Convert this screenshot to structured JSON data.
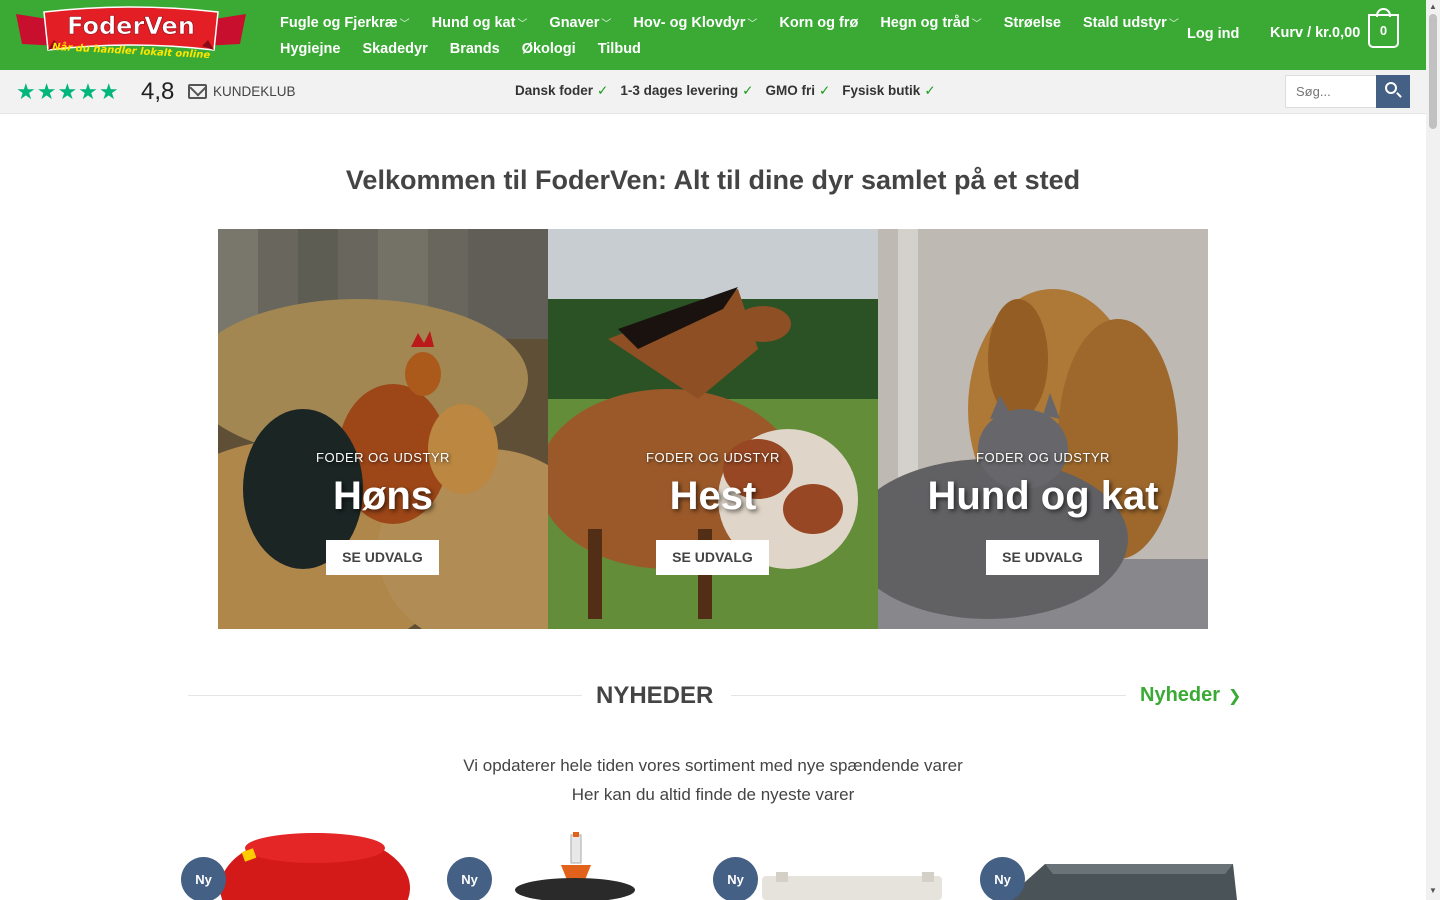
{
  "header": {
    "brand": "FoderVen",
    "tagline": "Når du handler lokalt online",
    "nav_row1": [
      "Fugle og Fjerkræ",
      "Hund og kat",
      "Gnaver",
      "Hov- og Klovdyr",
      "Korn og frø",
      "Hegn og tråd",
      "Strøelse",
      "Stald udstyr"
    ],
    "nav_row1_dropdown": [
      true,
      true,
      true,
      true,
      false,
      true,
      false,
      true
    ],
    "nav_row2": [
      "Hygiejne",
      "Skadedyr",
      "Brands",
      "Økologi",
      "Tilbud"
    ],
    "login": "Log ind",
    "cart": "Kurv / kr.0,00",
    "cart_count": "0",
    "colors": {
      "brand_green": "#3aaa35",
      "accent_blue": "#446084"
    }
  },
  "topbar": {
    "rating": "4,8",
    "stars": 5,
    "kundeklub": "KUNDEKLUB",
    "usps": [
      "Dansk foder",
      "1-3 dages levering",
      "GMO fri",
      "Fysisk butik"
    ],
    "search_placeholder": "Søg..."
  },
  "hero": {
    "welcome": "Velkommen til FoderVen: Alt til dine dyr samlet på et sted",
    "categories": [
      {
        "subtitle": "FODER OG UDSTYR",
        "title": "Høns",
        "button": "SE UDVALG"
      },
      {
        "subtitle": "FODER OG UDSTYR",
        "title": "Hest",
        "button": "SE UDVALG"
      },
      {
        "subtitle": "FODER OG UDSTYR",
        "title": "Hund og kat",
        "button": "SE UDVALG"
      }
    ]
  },
  "news": {
    "title": "NYHEDER",
    "link": "Nyheder",
    "desc_line1": "Vi opdaterer hele tiden vores sortiment med nye spændende varer",
    "desc_line2": "Her kan du altid finde de nyeste varer",
    "badge": "Ny"
  }
}
